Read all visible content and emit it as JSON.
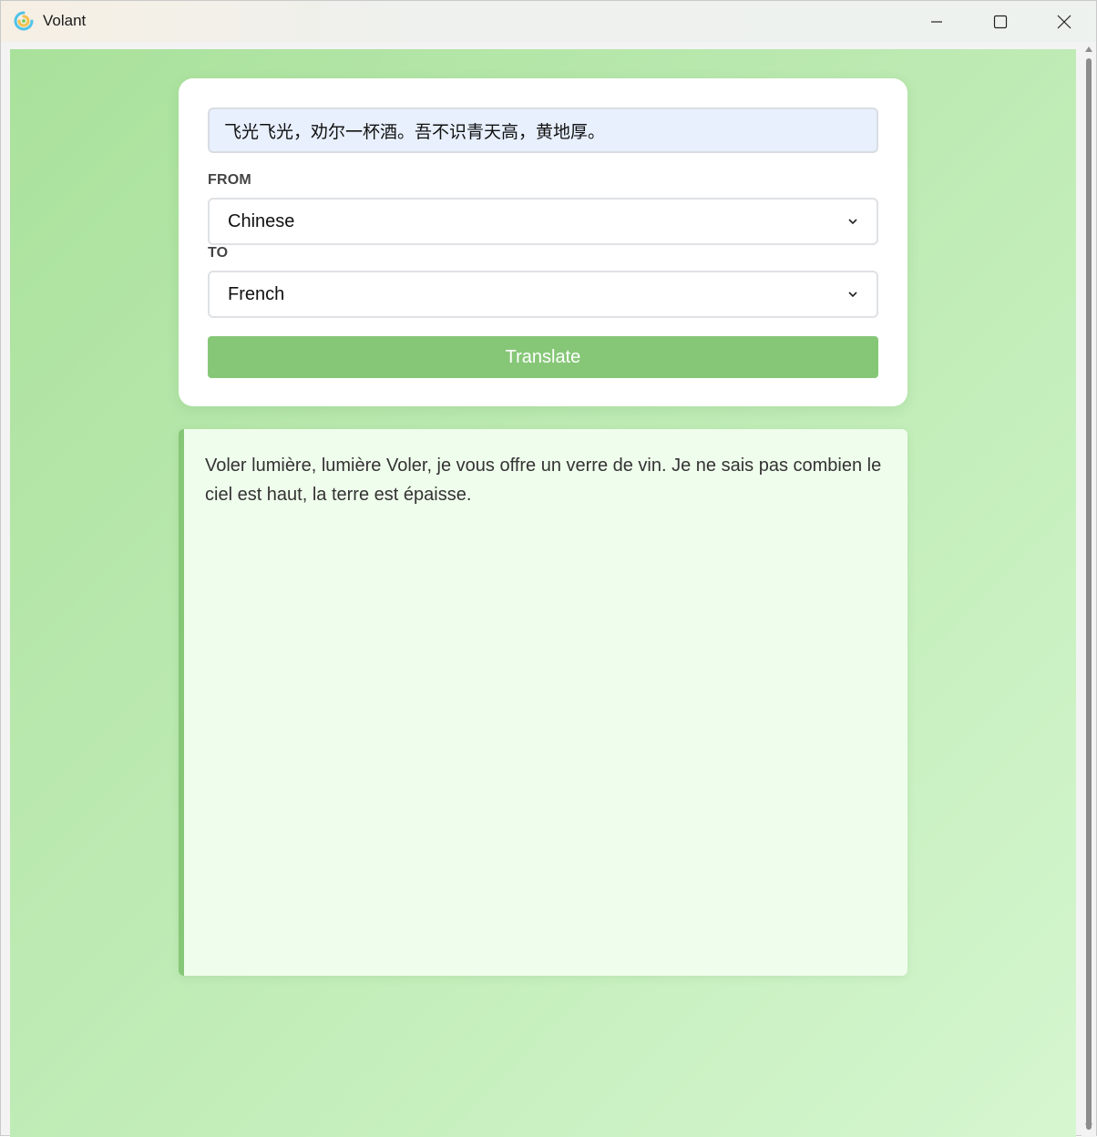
{
  "window": {
    "title": "Volant",
    "controls": [
      "minimize-icon",
      "maximize-icon",
      "close-icon"
    ]
  },
  "form": {
    "source_text": "飞光飞光，劝尔一杯酒。吾不识青天高，黄地厚。",
    "from_label": "FROM",
    "from_value": "Chinese",
    "to_label": "TO",
    "to_value": "French",
    "translate_label": "Translate"
  },
  "result": {
    "text": "Voler lumière, lumière Voler, je vous offre un verre de vin. Je ne sais pas combien le ciel est haut, la terre est épaisse."
  },
  "colors": {
    "accent": "#86c777",
    "result_bg": "#effdec",
    "input_bg": "#e8f0fe"
  }
}
